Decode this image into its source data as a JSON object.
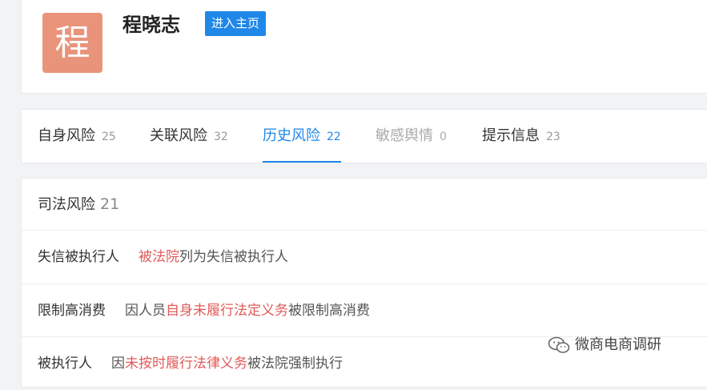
{
  "profile": {
    "avatar_char": "程",
    "name": "程晓志",
    "home_button": "进入主页",
    "avatar_color": "#e9947a"
  },
  "tabs": [
    {
      "label": "自身风险",
      "count": "25"
    },
    {
      "label": "关联风险",
      "count": "32"
    },
    {
      "label": "历史风险",
      "count": "22",
      "active": true
    },
    {
      "label": "敏感舆情",
      "count": "0",
      "disabled": true
    },
    {
      "label": "提示信息",
      "count": "23"
    }
  ],
  "section": {
    "title": "司法风险",
    "count": "21"
  },
  "rows": [
    {
      "label": "失信被执行人",
      "pre": "",
      "highlight": "被法院",
      "post": "列为失信被执行人"
    },
    {
      "label": "限制高消费",
      "pre": "因人员",
      "highlight": "自身未履行法定义务",
      "post": "被限制高消费"
    },
    {
      "label": "被执行人",
      "pre": "因",
      "highlight": "未按时履行法律义务",
      "post": "被法院强制执行"
    }
  ],
  "watermark": {
    "text": "微商电商调研",
    "icon": "wechat-icon"
  },
  "colors": {
    "accent": "#1f87e8",
    "highlight": "#e05a5a"
  }
}
